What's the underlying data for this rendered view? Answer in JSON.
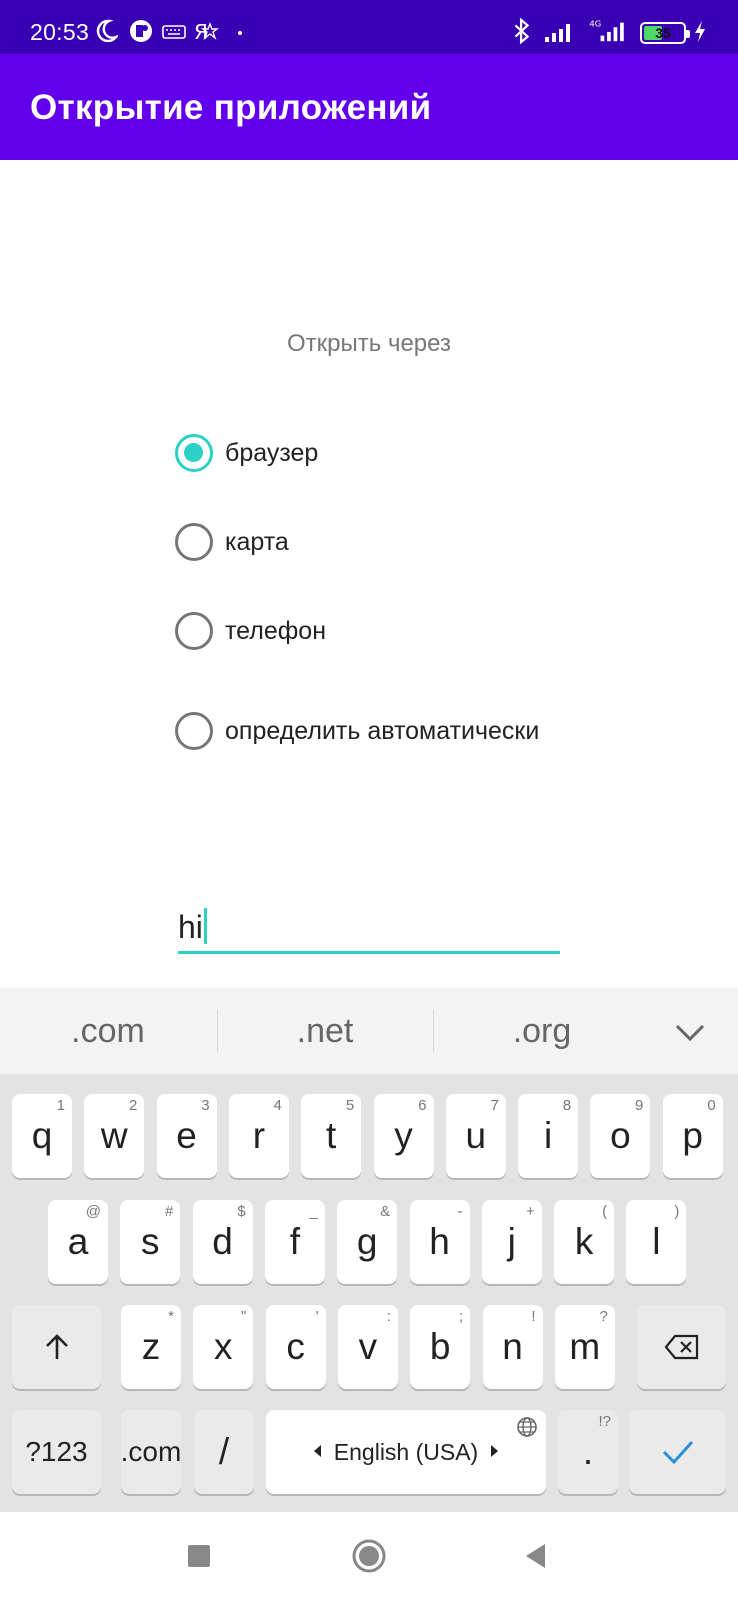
{
  "status_bar": {
    "time": "20:53",
    "battery_level": "35",
    "icons": [
      "moon-icon",
      "notification-icon",
      "keyboard-icon",
      "yandex-icon",
      "dot-icon",
      "bluetooth-icon",
      "signal-icon",
      "signal-4g-icon",
      "battery-icon",
      "charging-icon"
    ]
  },
  "app_bar": {
    "title": "Открытие приложений"
  },
  "content": {
    "open_via_label": "Открыть через",
    "options": [
      {
        "label": "браузер",
        "checked": true
      },
      {
        "label": "карта",
        "checked": false
      },
      {
        "label": "телефон",
        "checked": false
      },
      {
        "label": "определить автоматически",
        "checked": false
      }
    ],
    "input_value": "hi"
  },
  "suggestions": [
    ".com",
    ".net",
    ".org"
  ],
  "keyboard": {
    "row1": [
      {
        "k": "q",
        "h": "1"
      },
      {
        "k": "w",
        "h": "2"
      },
      {
        "k": "e",
        "h": "3"
      },
      {
        "k": "r",
        "h": "4"
      },
      {
        "k": "t",
        "h": "5"
      },
      {
        "k": "y",
        "h": "6"
      },
      {
        "k": "u",
        "h": "7"
      },
      {
        "k": "i",
        "h": "8"
      },
      {
        "k": "o",
        "h": "9"
      },
      {
        "k": "p",
        "h": "0"
      }
    ],
    "row2": [
      {
        "k": "a",
        "h": "@"
      },
      {
        "k": "s",
        "h": "#"
      },
      {
        "k": "d",
        "h": "$"
      },
      {
        "k": "f",
        "h": "_"
      },
      {
        "k": "g",
        "h": "&"
      },
      {
        "k": "h",
        "h": "-"
      },
      {
        "k": "j",
        "h": "+"
      },
      {
        "k": "k",
        "h": "("
      },
      {
        "k": "l",
        "h": ")"
      }
    ],
    "row3": [
      {
        "k": "z",
        "h": "*"
      },
      {
        "k": "x",
        "h": "\""
      },
      {
        "k": "c",
        "h": "'"
      },
      {
        "k": "v",
        "h": ":"
      },
      {
        "k": "b",
        "h": ";"
      },
      {
        "k": "n",
        "h": "!"
      },
      {
        "k": "m",
        "h": "?"
      }
    ],
    "symbols_key": "?123",
    "com_key": ".com",
    "slash_key": "/",
    "space_label": "English (USA)",
    "period_key": ".",
    "period_hint": "!?"
  },
  "colors": {
    "status_bar": "#3a00b3",
    "app_bar": "#6200ee",
    "accent": "#2ad1c4"
  }
}
